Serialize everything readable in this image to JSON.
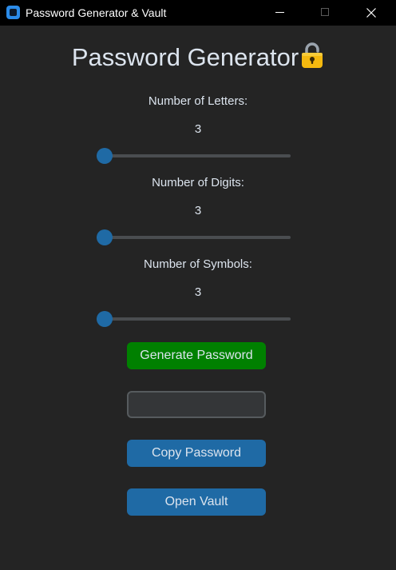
{
  "window": {
    "title": "Password Generator & Vault"
  },
  "main": {
    "heading": "Password Generator",
    "letters": {
      "label": "Number of Letters:",
      "value": "3",
      "level": 0
    },
    "digits": {
      "label": "Number of Digits:",
      "value": "3",
      "level": 0
    },
    "symbols": {
      "label": "Number of Symbols:",
      "value": "3",
      "level": 0
    },
    "generate_label": "Generate Password",
    "password_value": "",
    "copy_label": "Copy Password",
    "vault_label": "Open Vault"
  },
  "colors": {
    "background": "#242424",
    "accent": "#1f6aa5",
    "generate": "#008000",
    "text": "#dce4ee"
  },
  "icons": {
    "app": "app-icon",
    "lock": "lock-icon",
    "minimize": "minimize-icon",
    "maximize": "maximize-icon",
    "close": "close-icon"
  }
}
